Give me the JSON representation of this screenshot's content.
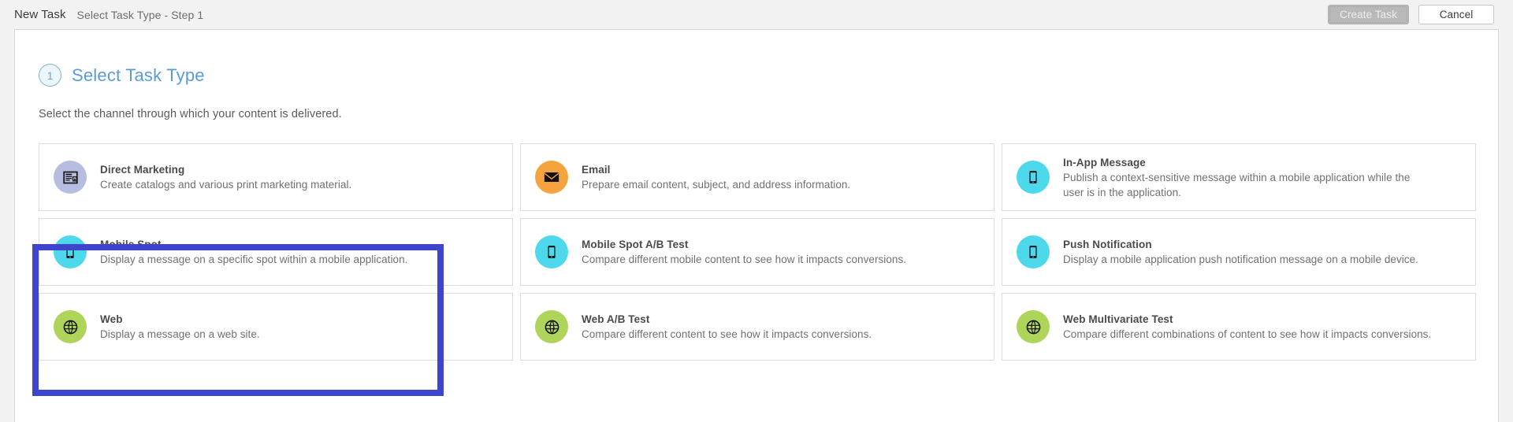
{
  "topbar": {
    "title": "New Task",
    "subtitle": "Select Task Type - Step 1",
    "create_label": "Create Task",
    "cancel_label": "Cancel"
  },
  "step": {
    "number": "1",
    "title": "Select Task Type",
    "instruction": "Select the channel through which your content is delivered."
  },
  "colors": {
    "selection_border": "#3f44cc",
    "direct_marketing": "#b6bde0",
    "email": "#f5a33f",
    "mobile": "#4ed8ec",
    "web": "#aed45a",
    "step_accent": "#5b9bd5"
  },
  "cards": [
    {
      "id": "direct-marketing",
      "title": "Direct Marketing",
      "desc": "Create catalogs and various print marketing material.",
      "icon": "newspaper-icon",
      "circle": "#b6bde0",
      "selected": false
    },
    {
      "id": "email",
      "title": "Email",
      "desc": "Prepare email content, subject, and address information.",
      "icon": "envelope-icon",
      "circle": "#f5a33f",
      "selected": false
    },
    {
      "id": "in-app-message",
      "title": "In-App Message",
      "desc": "Publish a context-sensitive message within a mobile application while the user is in the application.",
      "icon": "mobile-phone-icon",
      "circle": "#4ed8ec",
      "selected": false
    },
    {
      "id": "mobile-spot",
      "title": "Mobile Spot",
      "desc": "Display a message on a specific spot within a mobile application.",
      "icon": "mobile-phone-icon",
      "circle": "#4ed8ec",
      "selected": true
    },
    {
      "id": "mobile-spot-ab-test",
      "title": "Mobile Spot A/B Test",
      "desc": "Compare different mobile content to see how it impacts conversions.",
      "icon": "mobile-phone-icon",
      "circle": "#4ed8ec",
      "selected": false
    },
    {
      "id": "push-notification",
      "title": "Push Notification",
      "desc": "Display a mobile application push notification message on a mobile device.",
      "icon": "mobile-phone-icon",
      "circle": "#4ed8ec",
      "selected": false
    },
    {
      "id": "web",
      "title": "Web",
      "desc": "Display a message on a web site.",
      "icon": "globe-icon",
      "circle": "#aed45a",
      "selected": true
    },
    {
      "id": "web-ab-test",
      "title": "Web A/B Test",
      "desc": "Compare different content to see how it impacts conversions.",
      "icon": "globe-icon",
      "circle": "#aed45a",
      "selected": false
    },
    {
      "id": "web-multivariate-test",
      "title": "Web Multivariate Test",
      "desc": "Compare different combinations of content to see how it impacts conversions.",
      "icon": "globe-icon",
      "circle": "#aed45a",
      "selected": false
    }
  ]
}
